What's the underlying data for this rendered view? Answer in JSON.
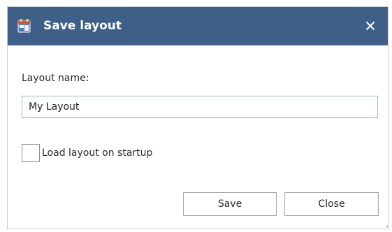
{
  "dialog": {
    "title": "Save layout",
    "icon": "layout-app-icon",
    "close_icon": "close-icon"
  },
  "form": {
    "name_label": "Layout name:",
    "name_value": "My Layout",
    "load_on_startup_label": "Load layout on startup",
    "load_on_startup_checked": false
  },
  "buttons": {
    "save_label": "Save",
    "close_label": "Close"
  },
  "colors": {
    "titlebar": "#3d5f88",
    "input_border": "#9fb6d5"
  }
}
